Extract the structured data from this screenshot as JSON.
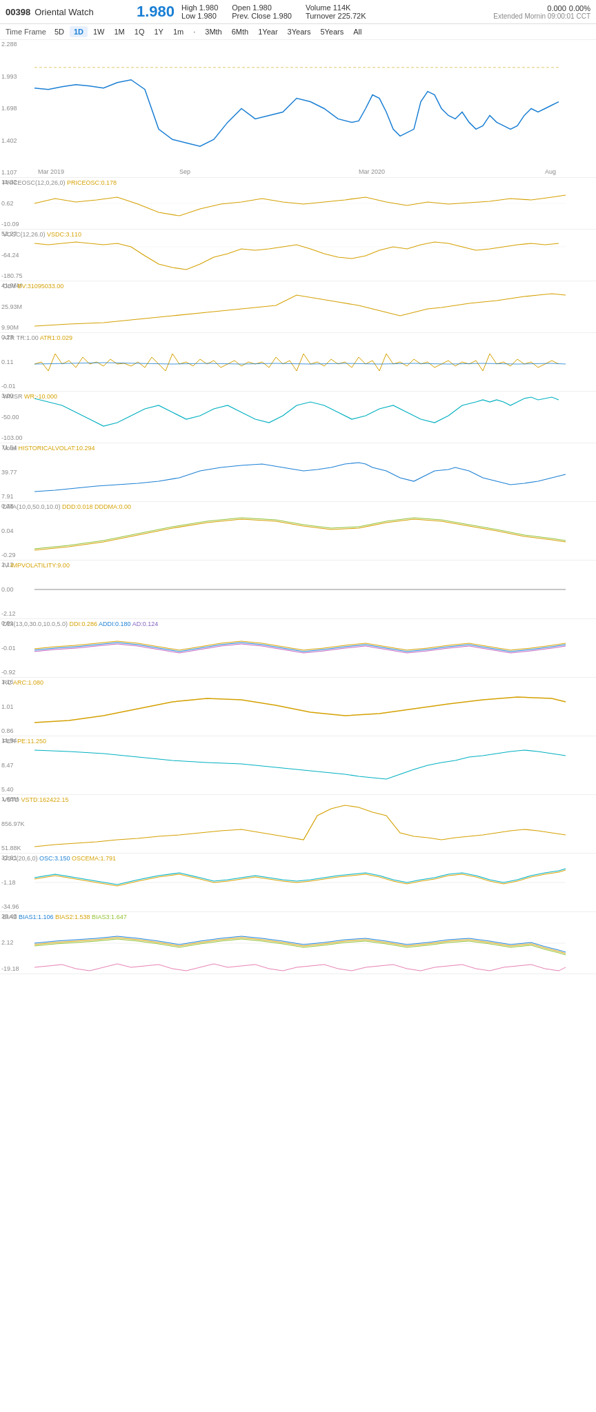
{
  "header": {
    "code": "00398",
    "name": "Oriental Watch",
    "price": "1.980",
    "high_label": "High",
    "high": "1.980",
    "low_label": "Low",
    "low": "1.980",
    "change": "0.000",
    "change_pct": "0.00%",
    "open_label": "Open",
    "open": "1.980",
    "prev_close_label": "Prev. Close",
    "prev_close": "1.980",
    "volume_label": "Volume",
    "volume": "114K",
    "turnover_label": "Turnover",
    "turnover": "225.72K",
    "session": "Extended Mornin",
    "time": "09:00:01 CCT"
  },
  "timeframe": {
    "label": "Time Frame",
    "buttons": [
      "5D",
      "1D",
      "1W",
      "1M",
      "1Q",
      "1Y",
      "1m",
      "·",
      "3Mth",
      "6Mth",
      "1Year",
      "3Years",
      "5Years",
      "All"
    ],
    "active": "1D"
  },
  "charts": [
    {
      "id": "price",
      "label": "",
      "y_labels": [
        "2.288",
        "1.993",
        "1.698",
        "1.402",
        "1.107"
      ],
      "x_labels": [
        "Mar 2019",
        "Sep",
        "Mar 2020",
        "Aug"
      ],
      "height": 170
    },
    {
      "id": "priceosc",
      "label": "PRICEOSC(12,0,26,0)",
      "label_val": "PRICEOSС:0.178",
      "y_labels": [
        "11.32",
        "0.62",
        "-10.09"
      ],
      "height": 70
    },
    {
      "id": "vosc",
      "label": "VOSC(12,26.0)",
      "label_val": "VSDC:3.110",
      "y_labels": [
        "52.27",
        "-64.24",
        "-180.75"
      ],
      "height": 70
    },
    {
      "id": "obv",
      "label": "OBV",
      "label_val": "BV:31095033.00",
      "y_labels": [
        "41.96M",
        "25.93M",
        "9.90M"
      ],
      "height": 70
    },
    {
      "id": "atr",
      "label": "ATR TR:1.00",
      "label_val": "ATR1:0.029",
      "y_labels": [
        "0.23",
        "0.11",
        "-0.01"
      ],
      "height": 80
    },
    {
      "id": "wmsr",
      "label": "WMSR",
      "label_val": "WR:-10.000",
      "y_labels": [
        "3.00",
        "-50.00",
        "-103.00"
      ],
      "height": 70
    },
    {
      "id": "volat",
      "label": "Volat",
      "label_val": "HISTORICALVOLAT:10.294",
      "y_labels": [
        "71.64",
        "39.77",
        "7.91"
      ],
      "height": 80
    },
    {
      "id": "dma",
      "label": "DMA(10,0,50.0,10.0)",
      "label_val": "DDD:0.018  DDDMA:0.00",
      "y_labels": [
        "0.38",
        "0.04",
        "-0.29"
      ],
      "height": 80
    },
    {
      "id": "iv",
      "label": "IV",
      "label_val": "IMPVOLATILITY:9.00",
      "y_labels": [
        "2.12",
        "0.00",
        "-2.12"
      ],
      "height": 80
    },
    {
      "id": "ddi",
      "label": "DDI(13,0,30.0,10.0,5.0)",
      "label_val": "DDI:0.286  ADDI:0.180  AD:0.124",
      "y_labels": [
        "0.91",
        "-0.01",
        "-0.92"
      ],
      "height": 80
    },
    {
      "id": "rc",
      "label": "RC",
      "label_val": "ARC:1.080",
      "y_labels": [
        "1.16",
        "1.01",
        "0.86"
      ],
      "height": 80
    },
    {
      "id": "per",
      "label": "PER",
      "label_val": "PE:11.250",
      "y_labels": [
        "11.54",
        "8.47",
        "5.40"
      ],
      "height": 80
    },
    {
      "id": "vstd",
      "label": "VSTD",
      "label_val": "VSTD:162422.15",
      "y_labels": [
        "1.66M",
        "856.97K",
        "51.88K"
      ],
      "height": 80
    },
    {
      "id": "osc",
      "label": "OSC(20,6,0)",
      "label_val": "OSC:3.150  OSCEMA:1.791",
      "y_labels": [
        "32.61",
        "-1.18",
        "-34.96"
      ],
      "height": 80
    },
    {
      "id": "bias",
      "label": "BIAS",
      "label_val": "BIAS1:1.106  BIAS2:1.538  BIAS3:1.647",
      "y_labels": [
        "23.43",
        "2.12",
        "-19.18"
      ],
      "height": 80
    }
  ]
}
